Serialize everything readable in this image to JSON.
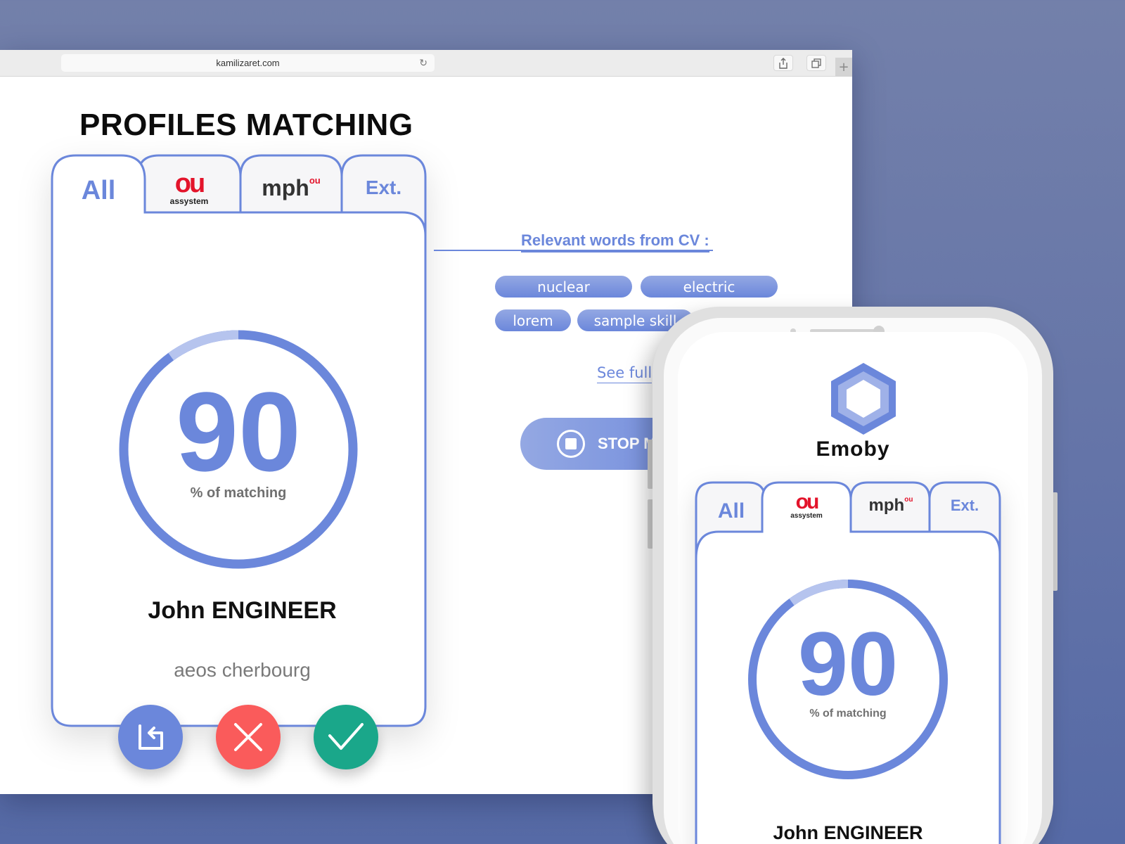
{
  "browser": {
    "url": "kamilizaret.com",
    "reload_icon": "reload-icon",
    "share_icon": "share-icon",
    "tabs_icon": "tabs-icon",
    "new_tab_label": "+"
  },
  "page": {
    "title": "PROFILES MATCHING"
  },
  "tabs": {
    "all": "All",
    "assystem_mark": "ou",
    "assystem_word": "assystem",
    "mph_word": "mph",
    "mph_sup": "ou",
    "ext": "Ext."
  },
  "profile": {
    "score": "90",
    "score_fraction": 0.9,
    "score_label": "% of matching",
    "name": "John ENGINEER",
    "company": "aeos cherbourg"
  },
  "actions": {
    "back_icon": "back-icon",
    "reject_icon": "close-icon",
    "accept_icon": "check-icon"
  },
  "relevant": {
    "title": "Relevant words from CV :",
    "words": [
      "nuclear",
      "electric",
      "lorem",
      "sample skill"
    ],
    "see_full": "See full",
    "stop_button": "STOP M"
  },
  "mobile": {
    "brand": "Emoby",
    "brand_icon": "hexagon-logo-icon",
    "tab_all": "All",
    "tab_ext": "Ext.",
    "score": "90",
    "score_label": "% of matching",
    "name": "John ENGINEER"
  },
  "colors": {
    "accent": "#6b87db",
    "accent_light": "#b6c4ee",
    "reject": "#fa5b5b",
    "accept": "#1aa78a",
    "background": "#6474a8"
  }
}
